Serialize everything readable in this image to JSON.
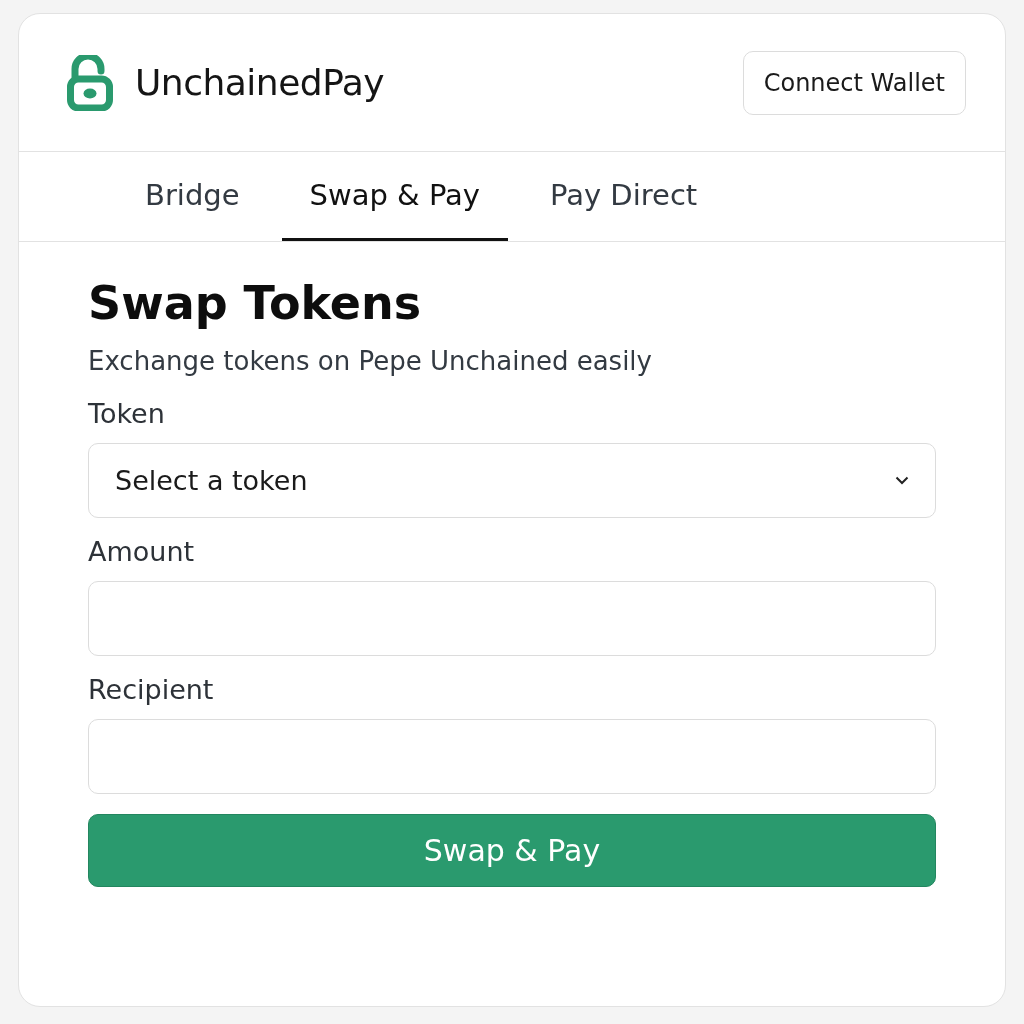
{
  "header": {
    "brand": "UnchainedPay",
    "connect_button": "Connect Wallet"
  },
  "tabs": [
    {
      "label": "Bridge",
      "selected": false
    },
    {
      "label": "Swap & Pay",
      "selected": true
    },
    {
      "label": "Pay Direct",
      "selected": false
    }
  ],
  "panel": {
    "title": "Swap Tokens",
    "subtitle": "Exchange tokens on Pepe Unchained easily",
    "fields": [
      {
        "kind": "select",
        "label": "Token",
        "value": "Select a token"
      },
      {
        "kind": "input",
        "label": "Amount"
      },
      {
        "kind": "input",
        "label": "Recipient"
      }
    ],
    "submit_button": "Swap & Pay"
  }
}
